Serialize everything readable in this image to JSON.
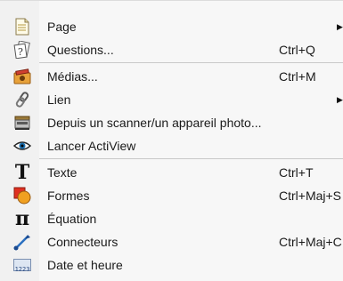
{
  "menu": {
    "items": [
      {
        "label": "Page",
        "shortcut": "",
        "submenu": true,
        "icon": "page-icon"
      },
      {
        "label": "Questions...",
        "shortcut": "Ctrl+Q",
        "submenu": false,
        "icon": "questions-icon"
      },
      {
        "label": "Médias...",
        "shortcut": "Ctrl+M",
        "submenu": false,
        "icon": "media-icon"
      },
      {
        "label": "Lien",
        "shortcut": "",
        "submenu": true,
        "icon": "link-icon"
      },
      {
        "label": "Depuis un scanner/un appareil photo...",
        "shortcut": "",
        "submenu": false,
        "icon": "scanner-icon"
      },
      {
        "label": "Lancer ActiView",
        "shortcut": "",
        "submenu": false,
        "icon": "eye-icon"
      },
      {
        "label": "Texte",
        "shortcut": "Ctrl+T",
        "submenu": false,
        "icon": "text-icon"
      },
      {
        "label": "Formes",
        "shortcut": "Ctrl+Maj+S",
        "submenu": false,
        "icon": "shapes-icon"
      },
      {
        "label": "Équation",
        "shortcut": "",
        "submenu": false,
        "icon": "pi-icon"
      },
      {
        "label": "Connecteurs",
        "shortcut": "Ctrl+Maj+C",
        "submenu": false,
        "icon": "connector-icon"
      },
      {
        "label": "Date et heure",
        "shortcut": "",
        "submenu": false,
        "icon": "calendar-icon"
      }
    ],
    "icon_glyphs": {
      "text": "T",
      "pi": "π",
      "calendar": "1223",
      "submenu_arrow": "▶"
    }
  }
}
